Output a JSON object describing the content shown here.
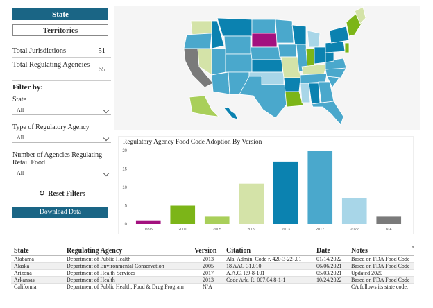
{
  "toggle": {
    "state": "State",
    "territories": "Territories"
  },
  "stats": [
    {
      "label": "Total Jurisdictions",
      "value": "51"
    },
    {
      "label": "Total Regulating Agencies",
      "value": "65"
    }
  ],
  "filters": {
    "title": "Filter by:",
    "items": [
      {
        "label": "State",
        "value": "All"
      },
      {
        "label": "Type of Regulatory Agency",
        "value": "All"
      },
      {
        "label": "Number of Agencies Regulating Retail Food",
        "value": "All"
      }
    ],
    "reset": "Reset Filters",
    "download": "Download Data"
  },
  "colors": {
    "primary": "#1a6585",
    "bar_1995": "#a3117f",
    "bar_2001": "#7cb518",
    "bar_2005": "#a9cf5a",
    "bar_2009": "#d4e3a8",
    "bar_2013": "#0b82b0",
    "bar_2017": "#4aa8cc",
    "bar_2022": "#a8d6e8",
    "bar_na": "#7a7a7a"
  },
  "chart_data": {
    "type": "bar",
    "title": "Regulatory Agency Food Code Adoption By Version",
    "categories": [
      "1995",
      "2001",
      "2005",
      "2009",
      "2013",
      "2017",
      "2022",
      "N/A"
    ],
    "values": [
      1,
      5,
      2,
      11,
      17,
      20,
      7,
      2
    ],
    "ylim": [
      0,
      20
    ],
    "yticks": [
      "0",
      "5",
      "10",
      "15",
      "20"
    ],
    "xlabel": "",
    "ylabel": ""
  },
  "table": {
    "headers": [
      "State",
      "Regulating Agency",
      "Version",
      "Citation",
      "Date",
      "Notes"
    ],
    "rows": [
      {
        "state": "Alabama",
        "agency": "Department of Public Health",
        "version": "2013",
        "citation": "Ala. Admin. Code r. 420-3-22-.01",
        "date": "01/14/2022",
        "notes": "Based on FDA Food Code"
      },
      {
        "state": "Alaska",
        "agency": "Department of Environmental Conservation",
        "version": "2005",
        "citation": "18 AAC 31.010",
        "date": "06/06/2021",
        "notes": "Based on FDA Food Code"
      },
      {
        "state": "Arizona",
        "agency": "Department of Health Services",
        "version": "2017",
        "citation": "A.A.C. R9-8-101",
        "date": "05/03/2021",
        "notes": "Updated 2020"
      },
      {
        "state": "Arkansas",
        "agency": "Department of Health",
        "version": "2013",
        "citation": "Code Ark. R. 007.04.8-1-1",
        "date": "10/24/2022",
        "notes": "Based on FDA Food Code"
      },
      {
        "state": "California",
        "agency": "Department of Public Health, Food & Drug Program",
        "version": "N/A",
        "citation": "",
        "date": "",
        "notes": "CA follows its state code,"
      }
    ]
  }
}
